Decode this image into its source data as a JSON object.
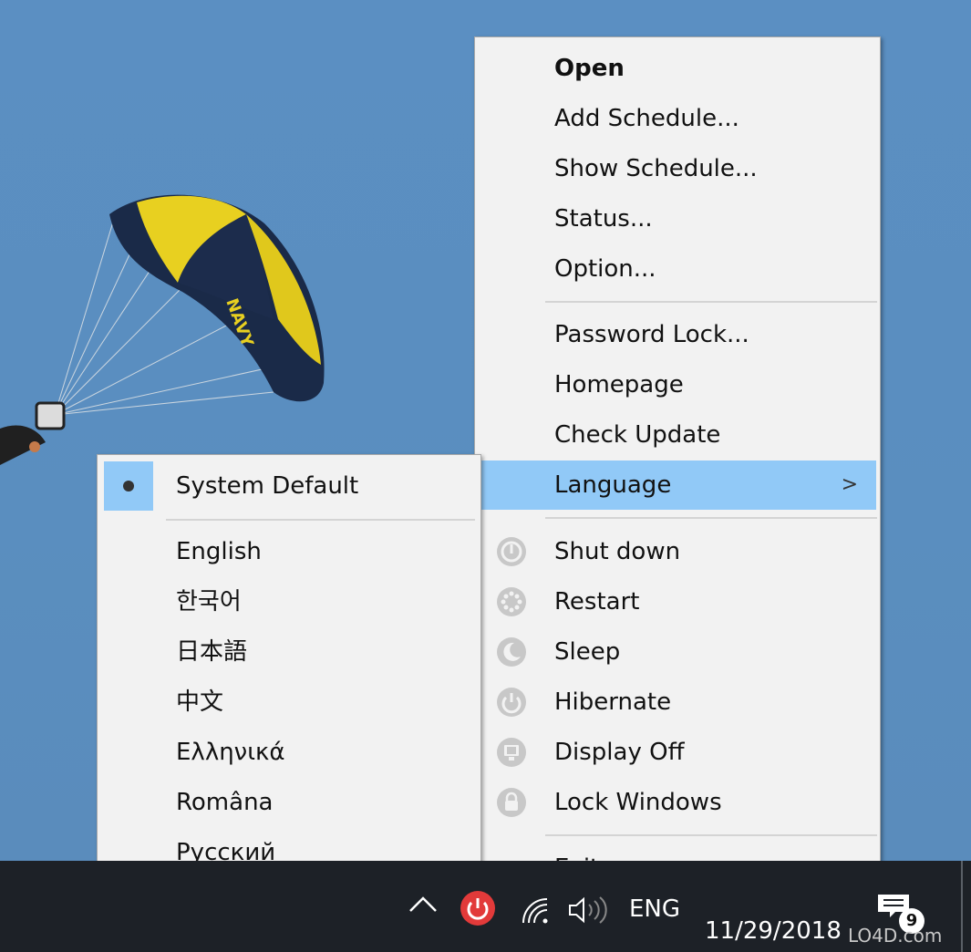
{
  "main_menu": {
    "items_top": [
      {
        "label": "Open"
      },
      {
        "label": "Add Schedule..."
      },
      {
        "label": "Show Schedule..."
      },
      {
        "label": "Status..."
      },
      {
        "label": "Option..."
      }
    ],
    "items_mid": [
      {
        "label": "Password Lock..."
      },
      {
        "label": "Homepage"
      },
      {
        "label": "Check Update"
      },
      {
        "label": "Language",
        "chevron": ">"
      }
    ],
    "items_power": [
      {
        "label": "Shut down",
        "icon": "power-icon"
      },
      {
        "label": "Restart",
        "icon": "restart-icon"
      },
      {
        "label": "Sleep",
        "icon": "moon-icon"
      },
      {
        "label": "Hibernate",
        "icon": "hibernate-icon"
      },
      {
        "label": "Display Off",
        "icon": "monitor-icon"
      },
      {
        "label": "Lock Windows",
        "icon": "lock-icon"
      }
    ],
    "exit_label": "Exit"
  },
  "language_menu": {
    "selected": "System Default",
    "items": [
      "English",
      "한국어",
      "日本語",
      "中文",
      "Ελληνικά",
      "Româna",
      "Русский"
    ]
  },
  "taskbar": {
    "language": "ENG",
    "date": "11/29/2018",
    "notification_count": "9",
    "watermark": "LO4D.com"
  },
  "colors": {
    "highlight": "#91c9f7",
    "menu_bg": "#f2f2f2",
    "taskbar_bg": "#1d2127",
    "app_tray_icon": "#e23a3a"
  }
}
